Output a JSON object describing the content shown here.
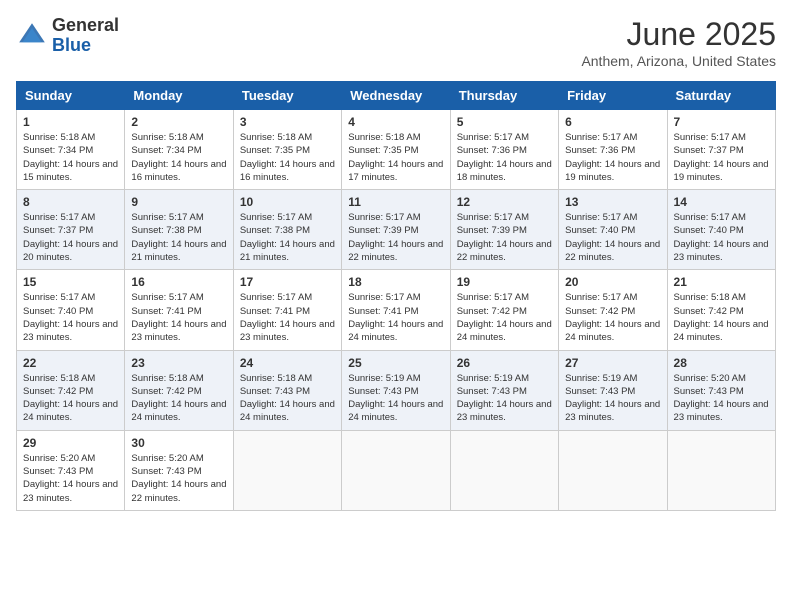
{
  "header": {
    "logo_general": "General",
    "logo_blue": "Blue",
    "month_year": "June 2025",
    "location": "Anthem, Arizona, United States"
  },
  "calendar": {
    "days_of_week": [
      "Sunday",
      "Monday",
      "Tuesday",
      "Wednesday",
      "Thursday",
      "Friday",
      "Saturday"
    ],
    "weeks": [
      [
        null,
        {
          "day": "2",
          "sunrise": "Sunrise: 5:18 AM",
          "sunset": "Sunset: 7:34 PM",
          "daylight": "Daylight: 14 hours and 16 minutes."
        },
        {
          "day": "3",
          "sunrise": "Sunrise: 5:18 AM",
          "sunset": "Sunset: 7:35 PM",
          "daylight": "Daylight: 14 hours and 16 minutes."
        },
        {
          "day": "4",
          "sunrise": "Sunrise: 5:18 AM",
          "sunset": "Sunset: 7:35 PM",
          "daylight": "Daylight: 14 hours and 17 minutes."
        },
        {
          "day": "5",
          "sunrise": "Sunrise: 5:17 AM",
          "sunset": "Sunset: 7:36 PM",
          "daylight": "Daylight: 14 hours and 18 minutes."
        },
        {
          "day": "6",
          "sunrise": "Sunrise: 5:17 AM",
          "sunset": "Sunset: 7:36 PM",
          "daylight": "Daylight: 14 hours and 19 minutes."
        },
        {
          "day": "7",
          "sunrise": "Sunrise: 5:17 AM",
          "sunset": "Sunset: 7:37 PM",
          "daylight": "Daylight: 14 hours and 19 minutes."
        }
      ],
      [
        {
          "day": "1",
          "sunrise": "Sunrise: 5:18 AM",
          "sunset": "Sunset: 7:34 PM",
          "daylight": "Daylight: 14 hours and 15 minutes."
        },
        null,
        null,
        null,
        null,
        null,
        null
      ],
      [
        {
          "day": "8",
          "sunrise": "Sunrise: 5:17 AM",
          "sunset": "Sunset: 7:37 PM",
          "daylight": "Daylight: 14 hours and 20 minutes."
        },
        {
          "day": "9",
          "sunrise": "Sunrise: 5:17 AM",
          "sunset": "Sunset: 7:38 PM",
          "daylight": "Daylight: 14 hours and 21 minutes."
        },
        {
          "day": "10",
          "sunrise": "Sunrise: 5:17 AM",
          "sunset": "Sunset: 7:38 PM",
          "daylight": "Daylight: 14 hours and 21 minutes."
        },
        {
          "day": "11",
          "sunrise": "Sunrise: 5:17 AM",
          "sunset": "Sunset: 7:39 PM",
          "daylight": "Daylight: 14 hours and 22 minutes."
        },
        {
          "day": "12",
          "sunrise": "Sunrise: 5:17 AM",
          "sunset": "Sunset: 7:39 PM",
          "daylight": "Daylight: 14 hours and 22 minutes."
        },
        {
          "day": "13",
          "sunrise": "Sunrise: 5:17 AM",
          "sunset": "Sunset: 7:40 PM",
          "daylight": "Daylight: 14 hours and 22 minutes."
        },
        {
          "day": "14",
          "sunrise": "Sunrise: 5:17 AM",
          "sunset": "Sunset: 7:40 PM",
          "daylight": "Daylight: 14 hours and 23 minutes."
        }
      ],
      [
        {
          "day": "15",
          "sunrise": "Sunrise: 5:17 AM",
          "sunset": "Sunset: 7:40 PM",
          "daylight": "Daylight: 14 hours and 23 minutes."
        },
        {
          "day": "16",
          "sunrise": "Sunrise: 5:17 AM",
          "sunset": "Sunset: 7:41 PM",
          "daylight": "Daylight: 14 hours and 23 minutes."
        },
        {
          "day": "17",
          "sunrise": "Sunrise: 5:17 AM",
          "sunset": "Sunset: 7:41 PM",
          "daylight": "Daylight: 14 hours and 23 minutes."
        },
        {
          "day": "18",
          "sunrise": "Sunrise: 5:17 AM",
          "sunset": "Sunset: 7:41 PM",
          "daylight": "Daylight: 14 hours and 24 minutes."
        },
        {
          "day": "19",
          "sunrise": "Sunrise: 5:17 AM",
          "sunset": "Sunset: 7:42 PM",
          "daylight": "Daylight: 14 hours and 24 minutes."
        },
        {
          "day": "20",
          "sunrise": "Sunrise: 5:17 AM",
          "sunset": "Sunset: 7:42 PM",
          "daylight": "Daylight: 14 hours and 24 minutes."
        },
        {
          "day": "21",
          "sunrise": "Sunrise: 5:18 AM",
          "sunset": "Sunset: 7:42 PM",
          "daylight": "Daylight: 14 hours and 24 minutes."
        }
      ],
      [
        {
          "day": "22",
          "sunrise": "Sunrise: 5:18 AM",
          "sunset": "Sunset: 7:42 PM",
          "daylight": "Daylight: 14 hours and 24 minutes."
        },
        {
          "day": "23",
          "sunrise": "Sunrise: 5:18 AM",
          "sunset": "Sunset: 7:42 PM",
          "daylight": "Daylight: 14 hours and 24 minutes."
        },
        {
          "day": "24",
          "sunrise": "Sunrise: 5:18 AM",
          "sunset": "Sunset: 7:43 PM",
          "daylight": "Daylight: 14 hours and 24 minutes."
        },
        {
          "day": "25",
          "sunrise": "Sunrise: 5:19 AM",
          "sunset": "Sunset: 7:43 PM",
          "daylight": "Daylight: 14 hours and 24 minutes."
        },
        {
          "day": "26",
          "sunrise": "Sunrise: 5:19 AM",
          "sunset": "Sunset: 7:43 PM",
          "daylight": "Daylight: 14 hours and 23 minutes."
        },
        {
          "day": "27",
          "sunrise": "Sunrise: 5:19 AM",
          "sunset": "Sunset: 7:43 PM",
          "daylight": "Daylight: 14 hours and 23 minutes."
        },
        {
          "day": "28",
          "sunrise": "Sunrise: 5:20 AM",
          "sunset": "Sunset: 7:43 PM",
          "daylight": "Daylight: 14 hours and 23 minutes."
        }
      ],
      [
        {
          "day": "29",
          "sunrise": "Sunrise: 5:20 AM",
          "sunset": "Sunset: 7:43 PM",
          "daylight": "Daylight: 14 hours and 23 minutes."
        },
        {
          "day": "30",
          "sunrise": "Sunrise: 5:20 AM",
          "sunset": "Sunset: 7:43 PM",
          "daylight": "Daylight: 14 hours and 22 minutes."
        },
        null,
        null,
        null,
        null,
        null
      ]
    ]
  }
}
